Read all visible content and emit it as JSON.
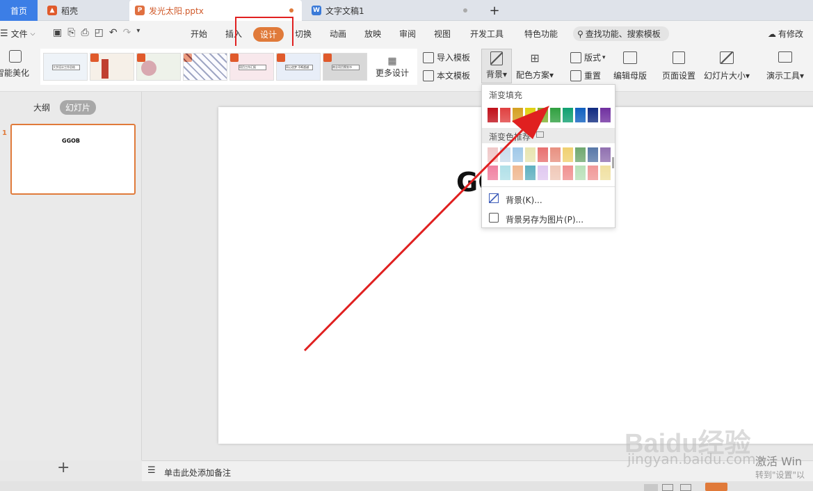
{
  "tabs": {
    "home": "首页",
    "app": "稻壳",
    "doc1": "发光太阳.pptx",
    "doc2": "文字文稿1",
    "new_tab": "+"
  },
  "menu": {
    "file": "文件",
    "items": [
      "开始",
      "插入",
      "设计",
      "切换",
      "动画",
      "放映",
      "审阅",
      "视图",
      "开发工具",
      "特色功能"
    ],
    "search": "查找功能、搜索模板",
    "cloud": "有修改"
  },
  "ribbon": {
    "smart_beautify": "智能美化",
    "more_design": "更多设计",
    "import_template": "导入模板",
    "this_template": "本文模板",
    "background": "背景",
    "color_scheme": "配色方案",
    "layout": "版式",
    "reset": "重置",
    "edit_master": "编辑母版",
    "page_setup": "页面设置",
    "slide_size": "幻灯片大小",
    "presentation_tools": "演示工具",
    "thumb_texts": [
      "大字设计工作总结",
      "",
      "",
      "",
      "项目工作汇报",
      "同心逆梦 不断超越",
      "商业项目策划书"
    ]
  },
  "panel": {
    "outline": "大纲",
    "slides": "幻灯片",
    "slide_number": "1",
    "slide_text": "GGOB",
    "add": "+"
  },
  "canvas": {
    "text": "GGOB"
  },
  "notes": {
    "placeholder": "单击此处添加备注"
  },
  "dropdown": {
    "gradient_fill": "渐变填充",
    "gradient_saved": "渐变色推荐",
    "background_item": "背景(K)...",
    "save_as_image": "背景另存为图片(P)...",
    "row1_colors": [
      "#c0101a",
      "#e04040",
      "#d4a020",
      "#e0d010",
      "#80b030",
      "#30a040",
      "#10a070",
      "#1060c0",
      "#102a80",
      "#7030a0"
    ],
    "row2_colors": [
      "#f0c8c8",
      "#c8dcec",
      "#a0c8e8",
      "#e8e4b0",
      "#e87070",
      "#e89080",
      "#f0d070",
      "#70a870",
      "#5878a8",
      "#9070b0"
    ],
    "row3_colors": [
      "#f080a0",
      "#b0e0e8",
      "#f0b890",
      "#60b0c0",
      "#e0c8f0",
      "#f0c8b8",
      "#f09090",
      "#b8e0b8",
      "#f09898",
      "#f0e0a0"
    ]
  },
  "watermark": {
    "brand": "Baidu经验",
    "url": "jingyan.baidu.com",
    "activate1": "激活 Win",
    "activate2": "转到\"设置\"以"
  },
  "colors": {
    "accent": "#e07a3a",
    "highlight_box": "#e02020",
    "arrow": "#e02020"
  }
}
